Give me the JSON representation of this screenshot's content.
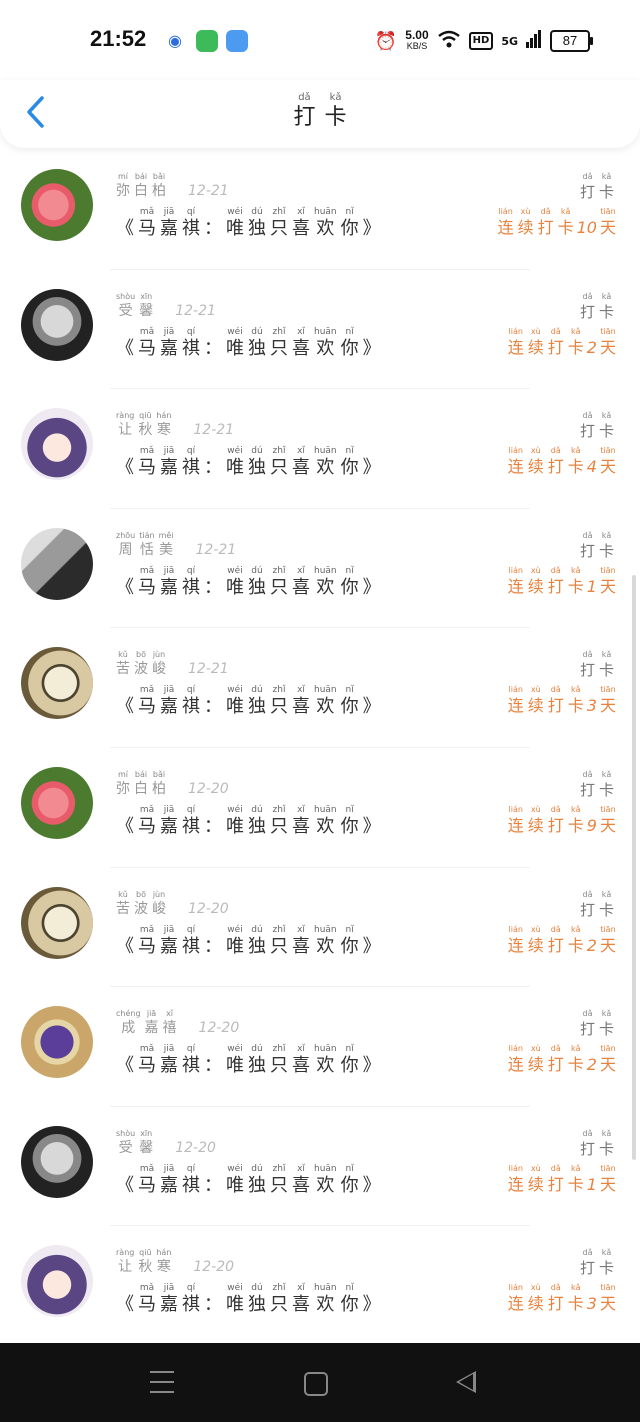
{
  "status_bar": {
    "time": "21:52",
    "speed_value": "5.00",
    "speed_unit": "KB/S",
    "hd": "HD",
    "network": "5G",
    "battery": "87"
  },
  "header": {
    "title": [
      {
        "py": "dǎ",
        "hz": "打"
      },
      {
        "py": "kǎ",
        "hz": "卡"
      }
    ]
  },
  "colors": {
    "accent": "#2b8ae6",
    "streak": "#e8833f"
  },
  "song": {
    "open": "《",
    "close": "》",
    "colon": "：",
    "words": [
      {
        "py": "mǎ",
        "hz": "马"
      },
      {
        "py": "jiā",
        "hz": "嘉"
      },
      {
        "py": "qí",
        "hz": "祺"
      },
      {
        "py": "wéi",
        "hz": "唯"
      },
      {
        "py": "dú",
        "hz": "独"
      },
      {
        "py": "zhǐ",
        "hz": "只"
      },
      {
        "py": "xǐ",
        "hz": "喜"
      },
      {
        "py": "huān",
        "hz": "欢"
      },
      {
        "py": "nǐ",
        "hz": "你"
      }
    ]
  },
  "checkin_label": [
    {
      "py": "dǎ",
      "hz": "打"
    },
    {
      "py": "kǎ",
      "hz": "卡"
    }
  ],
  "streak_words": [
    {
      "py": "lián",
      "hz": "连"
    },
    {
      "py": "xù",
      "hz": "续"
    },
    {
      "py": "dǎ",
      "hz": "打"
    },
    {
      "py": "kǎ",
      "hz": "卡"
    },
    {
      "py": "tiān",
      "hz": "天"
    }
  ],
  "rows": [
    {
      "avatar": "flower-avatar",
      "name": [
        {
          "py": "mí",
          "hz": "弥"
        },
        {
          "py": "bái",
          "hz": "白"
        },
        {
          "py": "bǎi",
          "hz": "柏"
        }
      ],
      "date": "12-21",
      "days": "10"
    },
    {
      "avatar": "man-avatar",
      "name": [
        {
          "py": "shòu",
          "hz": "受"
        },
        {
          "py": "xīn",
          "hz": "馨"
        }
      ],
      "date": "12-21",
      "days": "2"
    },
    {
      "avatar": "girl-avatar",
      "name": [
        {
          "py": "ràng",
          "hz": "让"
        },
        {
          "py": "qiū",
          "hz": "秋"
        },
        {
          "py": "hán",
          "hz": "寒"
        }
      ],
      "date": "12-21",
      "days": "4"
    },
    {
      "avatar": "hand-avatar",
      "name": [
        {
          "py": "zhōu",
          "hz": "周"
        },
        {
          "py": "tián",
          "hz": "恬"
        },
        {
          "py": "měi",
          "hz": "美"
        }
      ],
      "date": "12-21",
      "days": "1"
    },
    {
      "avatar": "clock-avatar",
      "name": [
        {
          "py": "kǔ",
          "hz": "苦"
        },
        {
          "py": "bō",
          "hz": "波"
        },
        {
          "py": "jùn",
          "hz": "峻"
        }
      ],
      "date": "12-21",
      "days": "3"
    },
    {
      "avatar": "flower-avatar",
      "name": [
        {
          "py": "mí",
          "hz": "弥"
        },
        {
          "py": "bái",
          "hz": "白"
        },
        {
          "py": "bǎi",
          "hz": "柏"
        }
      ],
      "date": "12-20",
      "days": "9"
    },
    {
      "avatar": "clock-avatar",
      "name": [
        {
          "py": "kǔ",
          "hz": "苦"
        },
        {
          "py": "bō",
          "hz": "波"
        },
        {
          "py": "jùn",
          "hz": "峻"
        }
      ],
      "date": "12-20",
      "days": "2"
    },
    {
      "avatar": "knight-avatar",
      "name": [
        {
          "py": "chéng",
          "hz": "成"
        },
        {
          "py": "jiā",
          "hz": "嘉"
        },
        {
          "py": "xǐ",
          "hz": "禧"
        }
      ],
      "date": "12-20",
      "days": "2"
    },
    {
      "avatar": "man-avatar",
      "name": [
        {
          "py": "shòu",
          "hz": "受"
        },
        {
          "py": "xīn",
          "hz": "馨"
        }
      ],
      "date": "12-20",
      "days": "1"
    },
    {
      "avatar": "girl-avatar",
      "name": [
        {
          "py": "ràng",
          "hz": "让"
        },
        {
          "py": "qiū",
          "hz": "秋"
        },
        {
          "py": "hán",
          "hz": "寒"
        }
      ],
      "date": "12-20",
      "days": "3"
    }
  ]
}
